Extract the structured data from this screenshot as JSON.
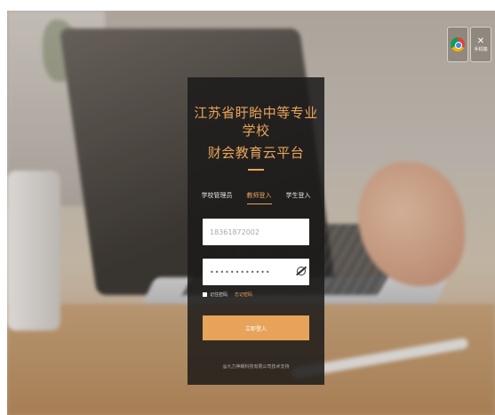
{
  "toolbar": {
    "chrome_icon": "chrome-icon",
    "tools_icon": "tools-icon",
    "tools_label": "手机端"
  },
  "login": {
    "title_line1": "江苏省盱眙中等专业学校",
    "title_line2": "财会教育云平台",
    "tabs": [
      {
        "label": "学校管理员",
        "active": false
      },
      {
        "label": "教师登入",
        "active": true
      },
      {
        "label": "学生登入",
        "active": false
      }
    ],
    "username_value": "18361872002",
    "password_value": "••••••••••••",
    "remember_label": "记住密码",
    "forgot_label": "忘记密码",
    "submit_label": "立即登入",
    "footer": "@九力神朝科技有限公司技术支持"
  },
  "colors": {
    "accent": "#e8a35b",
    "panel_bg": "#1c1b1a"
  }
}
